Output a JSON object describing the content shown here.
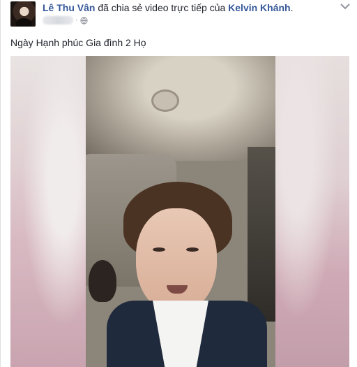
{
  "post": {
    "author": "Lê Thu Vân",
    "action": "đã chia sẻ video trực tiếp của",
    "shared_from": "Kelvin Khánh",
    "period": ".",
    "meta_separator": "·",
    "caption": "Ngày Hạnh phúc Gia đình 2 Họ",
    "icons": {
      "privacy": "globe-icon",
      "menu": "chevron-down-icon"
    }
  },
  "colors": {
    "link": "#365899",
    "text": "#1d2129",
    "meta": "#90949c"
  }
}
